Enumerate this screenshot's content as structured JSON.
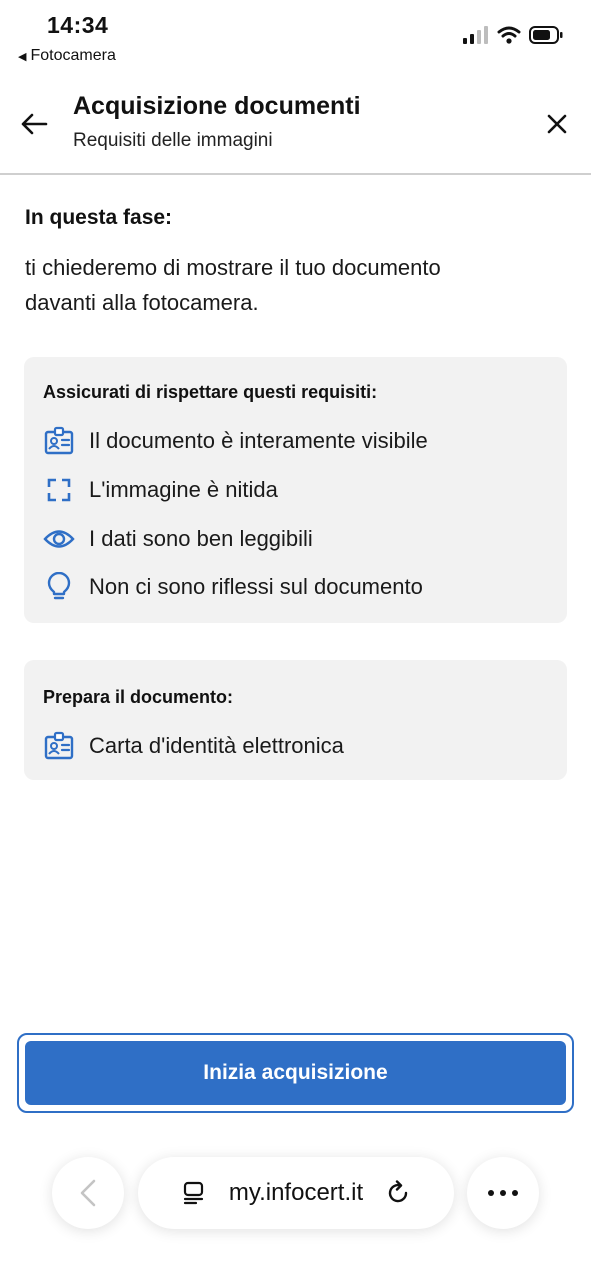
{
  "status_bar": {
    "time": "14:34",
    "back_app": "Fotocamera",
    "icons": [
      "signal-icon",
      "wifi-icon",
      "battery-icon"
    ]
  },
  "header": {
    "title": "Acquisizione documenti",
    "subtitle": "Requisiti delle immagini",
    "back_icon": "arrow-left-icon",
    "close_icon": "close-icon"
  },
  "intro": {
    "heading": "In questa fase:",
    "line1": "ti chiederemo di mostrare il tuo documento",
    "line2": "davanti alla fotocamera."
  },
  "requirements": {
    "title": "Assicurati di rispettare questi requisiti:",
    "items": [
      {
        "icon": "id-card-icon",
        "text": "Il documento è interamente visibile"
      },
      {
        "icon": "focus-frame-icon",
        "text": "L'immagine è nitida"
      },
      {
        "icon": "eye-icon",
        "text": "I dati sono ben leggibili"
      },
      {
        "icon": "lightbulb-icon",
        "text": "Non ci sono riflessi sul documento"
      }
    ]
  },
  "prepare": {
    "title": "Prepara il documento:",
    "items": [
      {
        "icon": "id-card-icon",
        "text": "Carta d'identità elettronica"
      }
    ]
  },
  "primary_button": {
    "label": "Inizia acquisizione"
  },
  "browser": {
    "url": "my.infocert.it",
    "icons": [
      "chevron-left-icon",
      "page-icon",
      "reload-icon",
      "more-icon"
    ]
  },
  "colors": {
    "accent": "#2f6fc6",
    "card_bg": "#f2f2f2",
    "divider": "#cfcfcf"
  }
}
